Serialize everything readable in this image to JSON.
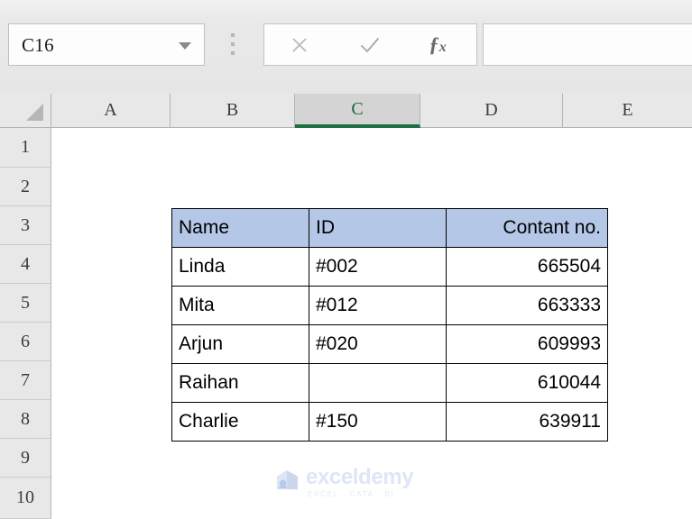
{
  "app": {
    "name_box_value": "C16",
    "formula_bar_value": "",
    "formula_bar_placeholder": "",
    "cancel_icon": "close-x-icon",
    "confirm_icon": "checkmark-icon",
    "function_icon": "fx-insert-function-icon",
    "namebox_caret_icon": "chevron-down-icon",
    "grip_icon": "drag-handle-dots-icon",
    "select_all_icon": "select-all-corner-triangle-icon"
  },
  "grid": {
    "column_headers": [
      "A",
      "B",
      "C",
      "D",
      "E"
    ],
    "selected_column": "C",
    "row_headers": [
      "1",
      "2",
      "3",
      "4",
      "5",
      "6",
      "7",
      "8",
      "9",
      "10"
    ]
  },
  "table": {
    "headers": [
      "Name",
      "ID",
      "Contant no."
    ],
    "rows": [
      {
        "name": "Linda",
        "id": "#002",
        "contact": "665504"
      },
      {
        "name": "Mita",
        "id": "#012",
        "contact": "663333"
      },
      {
        "name": "Arjun",
        "id": "#020",
        "contact": "609993"
      },
      {
        "name": "Raihan",
        "id": "",
        "contact": "610044"
      },
      {
        "name": "Charlie",
        "id": "#150",
        "contact": "639911"
      }
    ],
    "header_fill": "#B4C7E7",
    "border_color": "#000000"
  },
  "watermark": {
    "brand": "exceldemy",
    "tagline": "EXCEL · DATA · BI",
    "logo_icon": "exceldemy-cube-logo-icon",
    "color": "#DDE5F7"
  }
}
